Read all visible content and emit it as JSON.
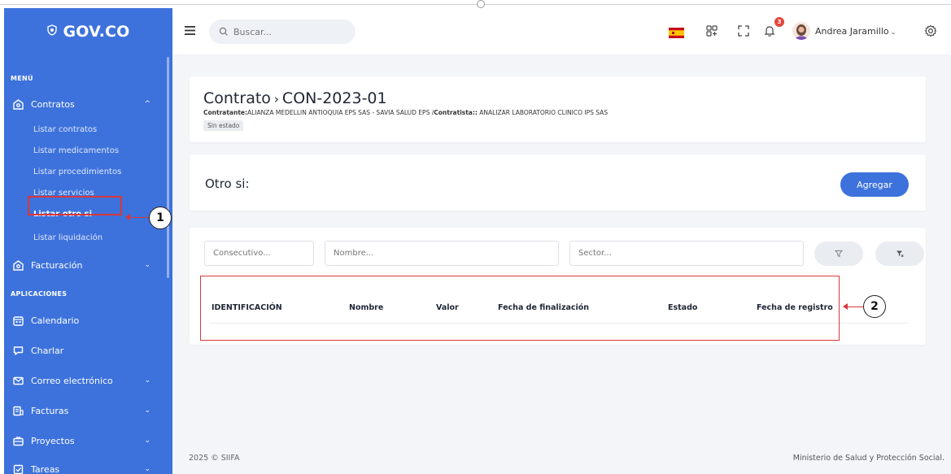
{
  "sidebar": {
    "brand": "GOV.CO",
    "menu_label": "MENÚ",
    "contratos": {
      "label": "Contratos",
      "caret": "^"
    },
    "sub_items": [
      "Listar contratos",
      "Listar medicamentos",
      "Listar procedimientos",
      "Listar servicios",
      "Listar otro si",
      "Listar liquidación"
    ],
    "facturacion": {
      "label": "Facturación",
      "caret": "⌄"
    },
    "apps_label": "APLICACIONES",
    "apps": [
      {
        "label": "Calendario",
        "caret": ""
      },
      {
        "label": "Charlar",
        "caret": ""
      },
      {
        "label": "Correo electrónico",
        "caret": "⌄"
      },
      {
        "label": "Facturas",
        "caret": "⌄"
      },
      {
        "label": "Proyectos",
        "caret": "⌄"
      },
      {
        "label": "Tareas",
        "caret": "⌄"
      }
    ]
  },
  "topbar": {
    "search_placeholder": "Buscar...",
    "notification_count": "3",
    "user_name": "Andrea Jaramillo",
    "user_caret": "⌄"
  },
  "header": {
    "crumb_root": "Contrato",
    "crumb_sep": "›",
    "crumb_current": "CON-2023-01",
    "contratante_label": "Contratante:",
    "contratante_value": "ALIANZA MEDELLIN ANTIOQUIA EPS SAS - SAVIA SALUD EPS /",
    "contratista_label": "Contratista::",
    "contratista_value": " ANALIZAR LABORATORIO CLINICO IPS SAS",
    "status": "Sin estado"
  },
  "otro_si": {
    "title": "Otro si:",
    "add_label": "Agregar"
  },
  "filters": {
    "consecutivo_placeholder": "Consecutivo...",
    "nombre_placeholder": "Nombre...",
    "sector_placeholder": "Sector..."
  },
  "table": {
    "columns": [
      "IDENTIFICACIÓN",
      "Nombre",
      "Valor",
      "Fecha de finalización",
      "Estado",
      "Fecha de registro"
    ]
  },
  "callouts": [
    "1",
    "2"
  ],
  "footer": {
    "left": "2025 © SIIFA",
    "right": "Ministerio de Salud y Protección Social."
  },
  "colors": {
    "sidebar": "#3d72dc",
    "accent": "#3d72dc",
    "callout_red": "#d9373b",
    "background": "#f3f5f9"
  }
}
